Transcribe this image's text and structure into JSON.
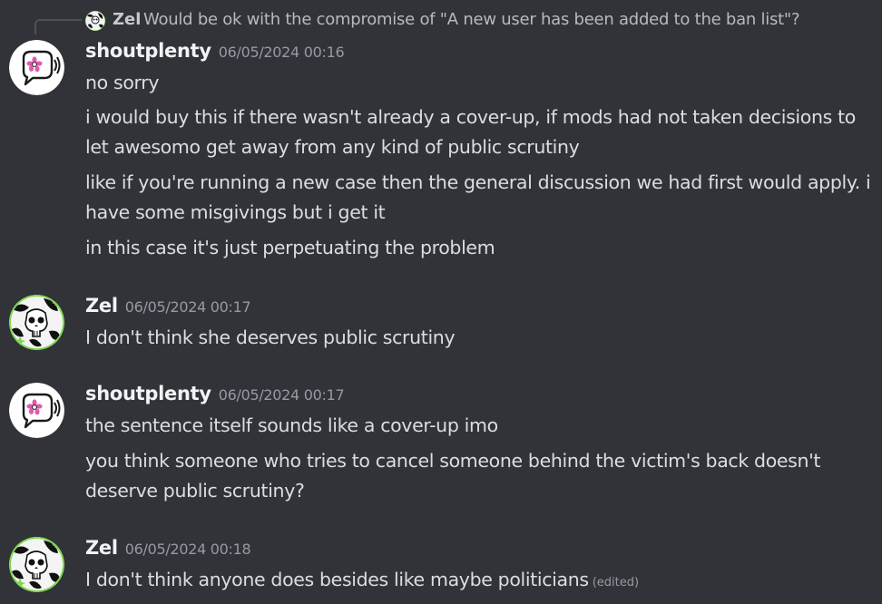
{
  "reply": {
    "author": "Zel",
    "text": "Would be ok with the compromise of \"A new user has been added to the ban list\"?"
  },
  "messages": [
    {
      "author": "shoutplenty",
      "timestamp": "06/05/2024 00:16",
      "lines": [
        "no sorry",
        "i would buy this if there wasn't already a cover-up, if mods had not taken decisions to",
        "let awesomo get away from any kind of public scrutiny",
        "like if you're running a new case then the general discussion we had first would apply. i",
        "have some misgivings but i get it",
        "in this case it's just perpetuating the problem"
      ]
    },
    {
      "author": "Zel",
      "timestamp": "06/05/2024 00:17",
      "lines": [
        "I don't think she deserves public scrutiny"
      ]
    },
    {
      "author": "shoutplenty",
      "timestamp": "06/05/2024 00:17",
      "lines": [
        "the sentence itself sounds like a cover-up imo",
        "you think someone who tries to cancel someone behind the victim's back doesn't",
        "deserve public scrutiny?"
      ]
    },
    {
      "author": "Zel",
      "timestamp": "06/05/2024 00:18",
      "lines": [
        "I don't think anyone does besides like maybe politicians"
      ],
      "edited": "(edited)"
    }
  ],
  "colors": {
    "background": "#313338",
    "username": "#f2f3f5",
    "text": "#dbdee1",
    "timestamp": "#949ba4",
    "zel_avatar_ring": "#7fd94e",
    "shout_avatar_flower": "#e05bb0"
  },
  "icons": {
    "shoutplenty_avatar": "speech-bubble-flower-icon",
    "zel_avatar": "skull-cow-pattern-icon"
  }
}
